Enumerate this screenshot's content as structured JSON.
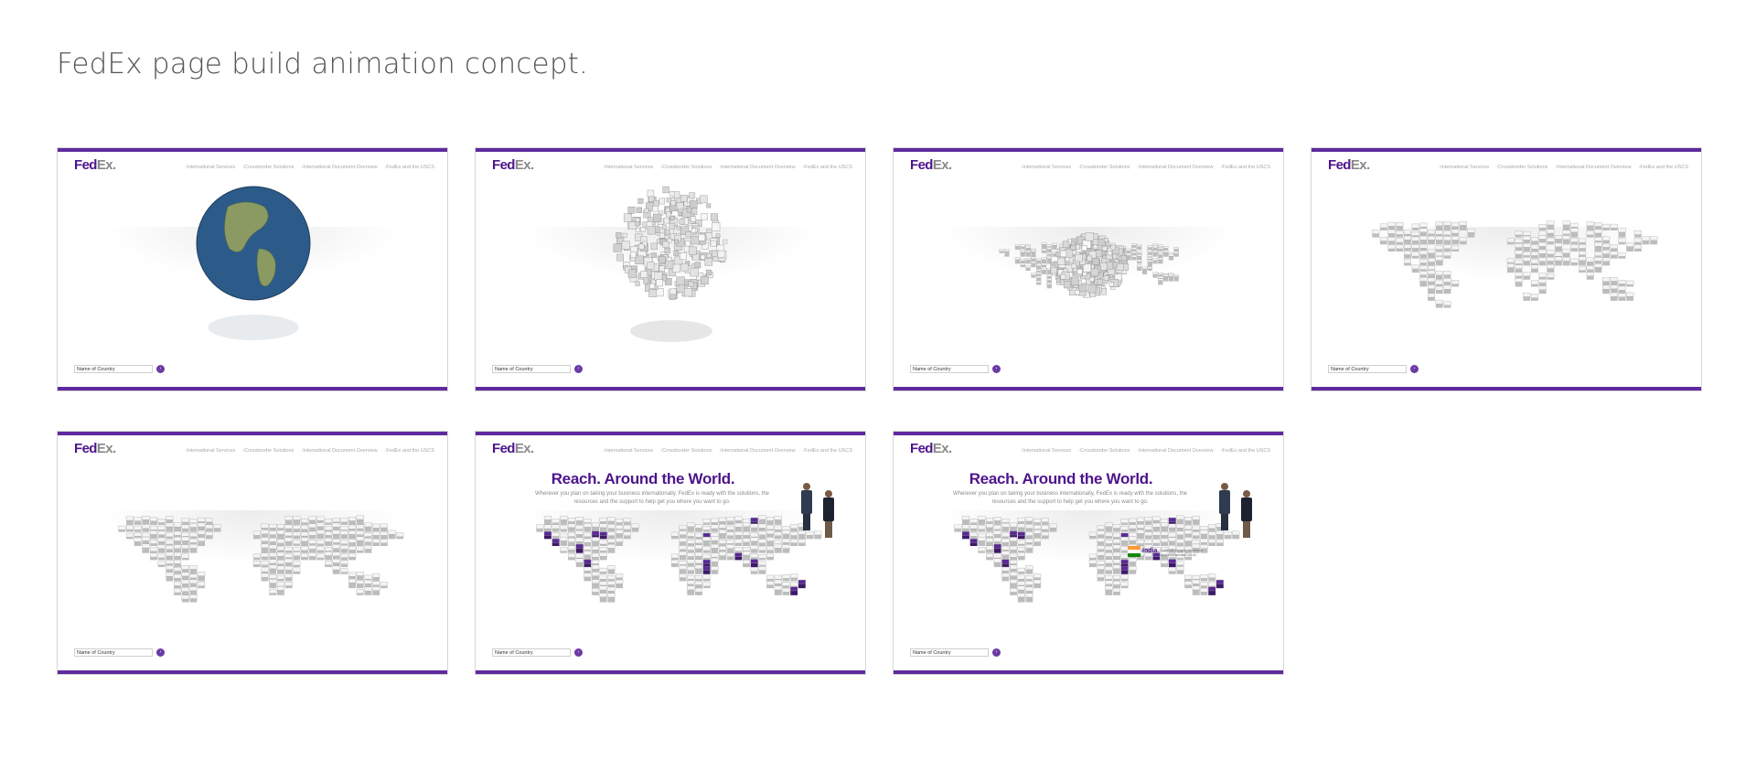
{
  "page": {
    "title": "FedEx page build animation concept."
  },
  "colors": {
    "fedex_purple": "#4d148c",
    "fedex_orange_gray": "#8a8a8a",
    "frame_bar": "#5f2a9e",
    "globe_ocean": "#2c5b8a"
  },
  "mockup": {
    "logo_fed": "Fed",
    "logo_ex": "Ex",
    "logo_dot": ".",
    "nav_items": [
      "International Services",
      "Crossborder Solutions",
      "International Document Overview",
      "FedEx and the USCS"
    ],
    "country_placeholder": "Name of Country",
    "go_icon": "arrow-right-icon",
    "headline": "Reach. Around the World.",
    "subtext": "Wherever you plan on taking your business internationally, FedEx is ready with the solutions, the resources and the support to help get you where you want to go.",
    "highlight_country": "India",
    "highlight_note": "Cultural, people, business and contact and so on"
  },
  "frames": [
    {
      "stage": "globe"
    },
    {
      "stage": "sphere-blocks"
    },
    {
      "stage": "sphere-unfolding"
    },
    {
      "stage": "map-forming"
    },
    {
      "stage": "map-complete"
    },
    {
      "stage": "map-with-headline"
    },
    {
      "stage": "map-with-country"
    }
  ]
}
